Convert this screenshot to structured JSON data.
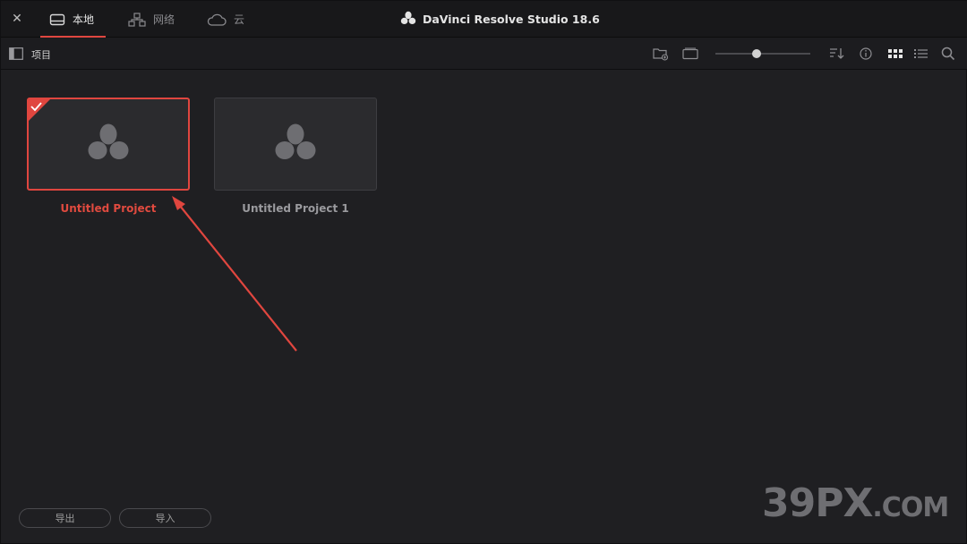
{
  "titlebar": {
    "close_label": "✕",
    "tabs": [
      {
        "label": "本地",
        "icon": "local-drive-icon",
        "active": true
      },
      {
        "label": "网络",
        "icon": "network-icon",
        "active": false
      },
      {
        "label": "云",
        "icon": "cloud-icon",
        "active": false
      }
    ],
    "app_title": "DaVinci Resolve Studio 18.6"
  },
  "toolbar": {
    "title": "项目",
    "thumbnail_zoom": 0.43
  },
  "projects": [
    {
      "name": "Untitled Project",
      "selected": true
    },
    {
      "name": "Untitled Project 1",
      "selected": false
    }
  ],
  "footer": {
    "export_label": "导出",
    "import_label": "导入"
  },
  "watermark": {
    "main": "39PX",
    "suffix": ".COM"
  },
  "colors": {
    "accent": "#e0463f",
    "background": "#1f1f22",
    "titlebar": "#18181a"
  }
}
